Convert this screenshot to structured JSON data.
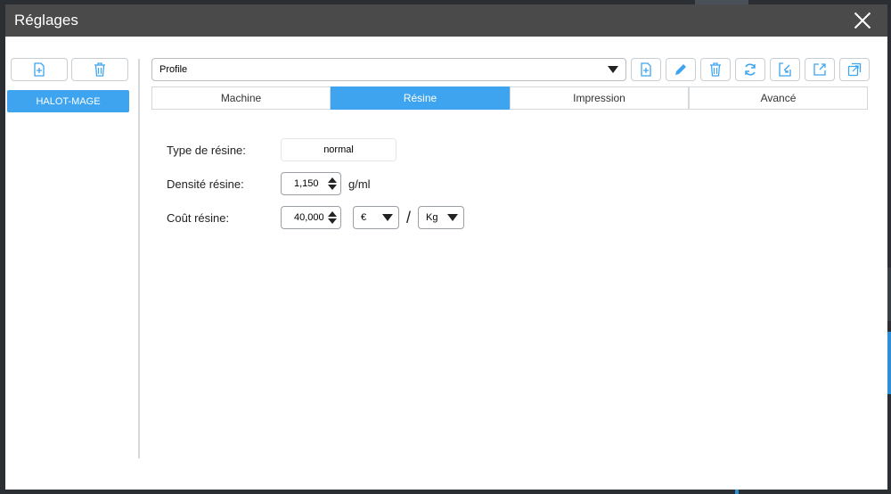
{
  "dialog": {
    "title": "Réglages"
  },
  "left": {
    "profiles": [
      {
        "label": "HALOT-MAGE"
      }
    ]
  },
  "profile_select": {
    "value": "Profile"
  },
  "tabs": [
    {
      "label": "Machine"
    },
    {
      "label": "Résine"
    },
    {
      "label": "Impression"
    },
    {
      "label": "Avancé"
    }
  ],
  "form": {
    "resin_type": {
      "label": "Type de résine:",
      "value": "normal"
    },
    "density": {
      "label": "Densité résine:",
      "value": "1,150",
      "unit": "g/ml"
    },
    "cost": {
      "label": "Coût résine:",
      "value": "40,000",
      "currency": "€",
      "separator": "/",
      "per_unit": "Kg"
    }
  },
  "colors": {
    "accent": "#3ea4ef",
    "titlebar": "#4a4a4a"
  }
}
